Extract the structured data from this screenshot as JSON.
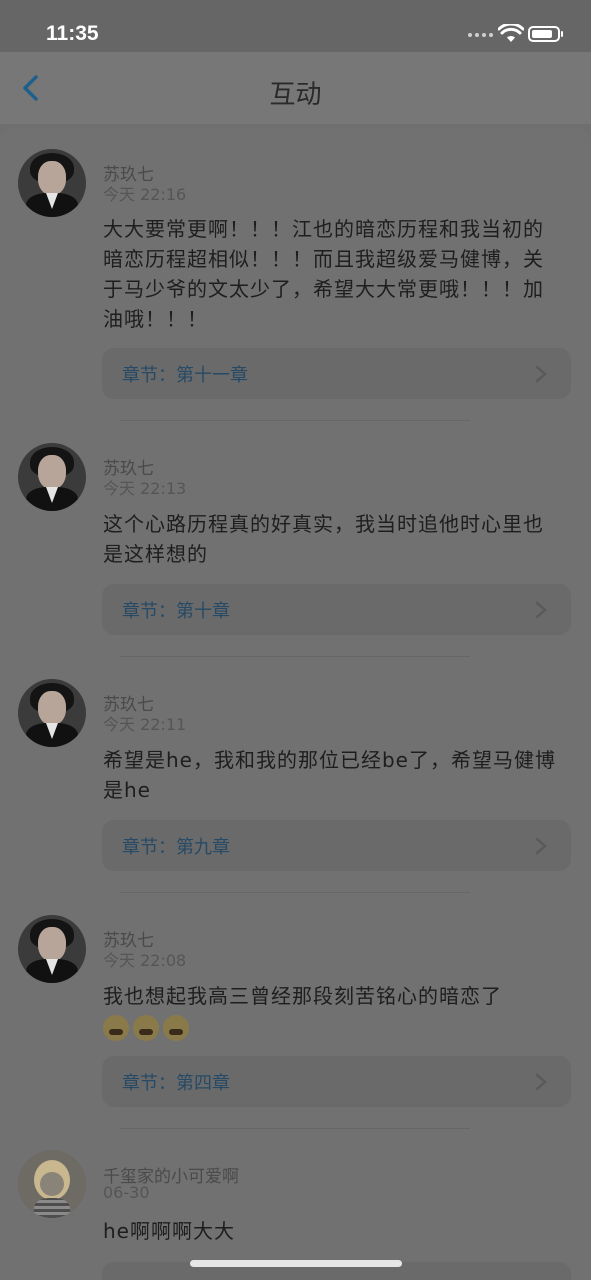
{
  "status_bar": {
    "time": "11:35"
  },
  "navbar": {
    "title": "互动"
  },
  "comments": [
    {
      "user": "苏玖七",
      "time": "今天 22:16",
      "text": "大大要常更啊！！！江也的暗恋历程和我当初的暗恋历程超相似！！！而且我超级爱马健博，关于马少爷的文太少了，希望大大常更哦！！！加油哦！！！",
      "chapter": "章节：第十一章"
    },
    {
      "user": "苏玖七",
      "time": "今天 22:13",
      "text": "这个心路历程真的好真实，我当时追他时心里也是这样想的",
      "chapter": "章节：第十章"
    },
    {
      "user": "苏玖七",
      "time": "今天 22:11",
      "text": "希望是he，我和我的那位已经be了，希望马健博是he",
      "chapter": "章节：第九章"
    },
    {
      "user": "苏玖七",
      "time": "今天 22:08",
      "text": "我也想起我高三曾经那段刻苦铭心的暗恋了",
      "chapter": "章节：第四章"
    },
    {
      "user": "千玺家的小可爱啊",
      "time": "06-30",
      "text": "he啊啊啊大大",
      "chapter": ""
    }
  ]
}
